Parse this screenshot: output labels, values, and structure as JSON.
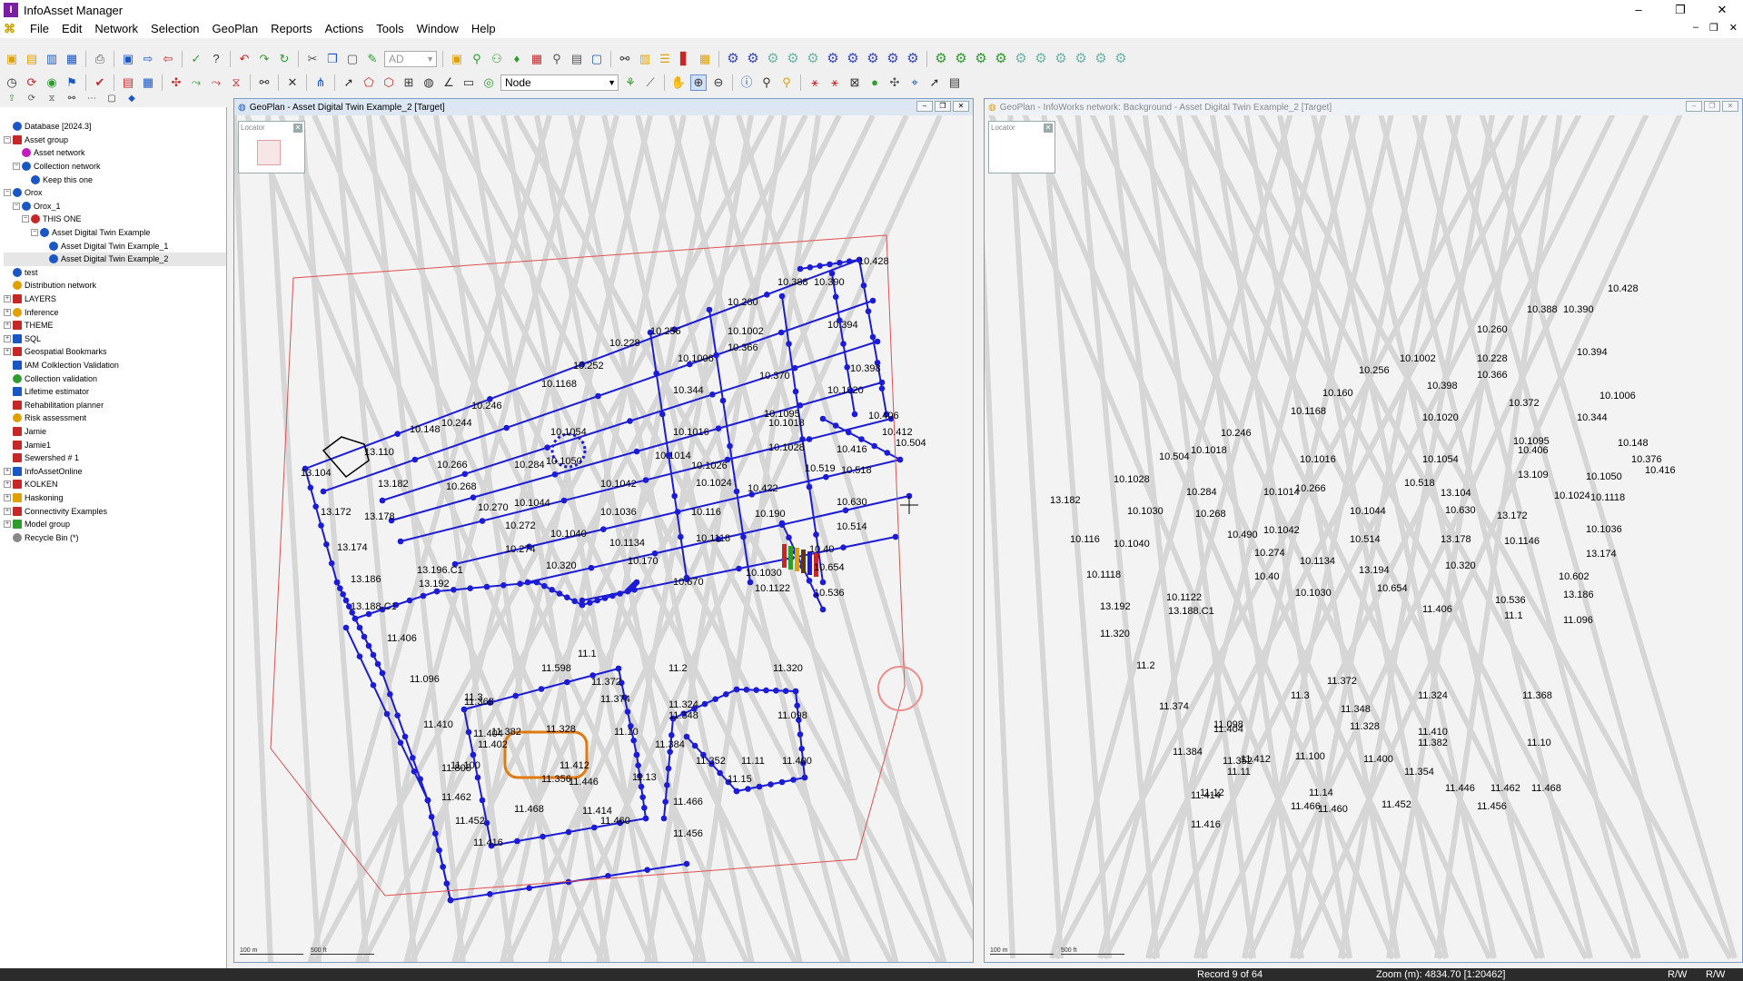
{
  "app": {
    "title": "InfoAsset Manager"
  },
  "window_controls": {
    "minimize": "–",
    "maximize": "❐",
    "close": "✕"
  },
  "menu": [
    "File",
    "Edit",
    "Network",
    "Selection",
    "GeoPlan",
    "Reports",
    "Actions",
    "Tools",
    "Window",
    "Help"
  ],
  "mdi_controls": {
    "minimize": "–",
    "restore": "❐",
    "close": "✕"
  },
  "toolbar": {
    "ad_combo": "AD",
    "node_combo": "Node"
  },
  "tree": [
    {
      "label": "Database [2024.3]",
      "level": 0,
      "pm": "",
      "icon": "#1a56c4"
    },
    {
      "label": "Asset group",
      "level": 0,
      "pm": "−",
      "icon": "#c62828",
      "sq": true
    },
    {
      "label": "Asset network",
      "level": 1,
      "pm": "",
      "icon": "#c41bc4"
    },
    {
      "label": "Collection network",
      "level": 1,
      "pm": "−",
      "icon": "#1a56c4"
    },
    {
      "label": "Keep this one",
      "level": 2,
      "pm": "",
      "icon": "#1a56c4"
    },
    {
      "label": "Orox",
      "level": 0,
      "pm": "−",
      "icon": "#1a56c4"
    },
    {
      "label": "Orox_1",
      "level": 1,
      "pm": "−",
      "icon": "#1a56c4"
    },
    {
      "label": "THIS ONE",
      "level": 2,
      "pm": "−",
      "icon": "#c62828"
    },
    {
      "label": "Asset Digital Twin Example",
      "level": 3,
      "pm": "−",
      "icon": "#1a56c4"
    },
    {
      "label": "Asset Digital Twin Example_1",
      "level": 4,
      "pm": "",
      "icon": "#1a56c4"
    },
    {
      "label": "Asset Digital Twin Example_2",
      "level": 4,
      "pm": "",
      "icon": "#1a56c4",
      "selected": true
    },
    {
      "label": "test",
      "level": 0,
      "pm": "",
      "icon": "#1a56c4"
    },
    {
      "label": "Distribution network",
      "level": 0,
      "pm": "",
      "icon": "#e0a000"
    },
    {
      "label": "LAYERS",
      "level": 0,
      "pm": "+",
      "icon": "#c62828",
      "sq": true
    },
    {
      "label": "Inference",
      "level": 0,
      "pm": "+",
      "icon": "#e0a000"
    },
    {
      "label": "THEME",
      "level": 0,
      "pm": "+",
      "icon": "#c62828",
      "sq": true
    },
    {
      "label": "SQL",
      "level": 0,
      "pm": "+",
      "icon": "#1a56c4",
      "sq": true
    },
    {
      "label": "Geospatial Bookmarks",
      "level": 0,
      "pm": "+",
      "icon": "#c62828",
      "sq": true
    },
    {
      "label": "IAM Colklection Validation",
      "level": 0,
      "pm": "",
      "icon": "#1a56c4",
      "sq": true
    },
    {
      "label": "Collection validation",
      "level": 0,
      "pm": "",
      "icon": "#2e9d2e"
    },
    {
      "label": "Lifetime estimator",
      "level": 0,
      "pm": "",
      "icon": "#1a56c4",
      "sq": true
    },
    {
      "label": "Rehabilitation planner",
      "level": 0,
      "pm": "",
      "icon": "#c62828",
      "sq": true
    },
    {
      "label": "Risk assessment",
      "level": 0,
      "pm": "",
      "icon": "#e0a000"
    },
    {
      "label": "Jamie",
      "level": 0,
      "pm": "",
      "icon": "#c62828",
      "sq": true
    },
    {
      "label": "Jamie1",
      "level": 0,
      "pm": "",
      "icon": "#c62828",
      "sq": true
    },
    {
      "label": "Sewershed # 1",
      "level": 0,
      "pm": "",
      "icon": "#c62828",
      "sq": true
    },
    {
      "label": "InfoAssetOnline",
      "level": 0,
      "pm": "+",
      "icon": "#1a56c4",
      "sq": true
    },
    {
      "label": "KOLKEN",
      "level": 0,
      "pm": "+",
      "icon": "#c62828",
      "sq": true
    },
    {
      "label": "Haskoning",
      "level": 0,
      "pm": "+",
      "icon": "#e0a000",
      "sq": true
    },
    {
      "label": "Connectivity Examples",
      "level": 0,
      "pm": "+",
      "icon": "#c62828",
      "sq": true
    },
    {
      "label": "Model group",
      "level": 0,
      "pm": "+",
      "icon": "#2e9d2e",
      "sq": true
    },
    {
      "label": "Recycle Bin (*)",
      "level": 0,
      "pm": "",
      "icon": "#888"
    }
  ],
  "geoplan_left": {
    "title": "GeoPlan - Asset Digital Twin Example_2 [Target]",
    "locator": "Locator",
    "scale_m": "100 m",
    "scale_ft": "500 ft"
  },
  "geoplan_right": {
    "title": "GeoPlan - InfoWorks network: Background - Asset Digital Twin Example_2 [Target]",
    "locator": "Locator",
    "scale_m": "100 m",
    "scale_ft": "500 ft"
  },
  "labels_left": [
    "10.428",
    "10.388",
    "10.390",
    "10.260",
    "10.394",
    "10.256",
    "10.1002",
    "10.228",
    "10.366",
    "10.1006",
    "10.252",
    "10.398",
    "10.370",
    "10.1168",
    "10.344",
    "10.1020",
    "10.246",
    "10.1095",
    "10.244",
    "10.1018",
    "10.406",
    "10.148",
    "10.1016",
    "10.412",
    "10.1054",
    "10.504",
    "13.110",
    "10.1028",
    "10.1050",
    "10.266",
    "10.416",
    "10.284",
    "10.1014",
    "10.1026",
    "10.519",
    "10.518",
    "13.104",
    "10.268",
    "13.182",
    "10.1042",
    "10.1024",
    "10.422",
    "10.1044",
    "10.630",
    "13.172",
    "10.1036",
    "10.116",
    "10.190",
    "13.178",
    "10.270",
    "10.514",
    "10.272",
    "10.1040",
    "13.174",
    "10.274",
    "10.1134",
    "10.1118",
    "10.40",
    "10.320",
    "10.170",
    "10.654",
    "13.186",
    "13.196.C1",
    "10.1030",
    "13.192",
    "10.670",
    "10.1122",
    "10.536",
    "13.188.C1",
    "11.406",
    "11.1",
    "11.598",
    "11.2",
    "11.320",
    "11.096",
    "11.372",
    "11.3",
    "11.324",
    "11.368",
    "11.374",
    "11.348",
    "11.098",
    "11.410",
    "11.404",
    "11.328",
    "11.382",
    "11.10",
    "11.402",
    "11.384",
    "11.352",
    "11.100",
    "11.412",
    "11.11",
    "11.400",
    "11.808",
    "11.356",
    "11.13",
    "11.446",
    "11.15",
    "11.462",
    "11.468",
    "11.414",
    "11.466",
    "11.452",
    "11.460",
    "11.456",
    "11.416"
  ],
  "labels_right": [
    "10.428",
    "10.388",
    "10.390",
    "10.260",
    "10.394",
    "10.1002",
    "10.228",
    "10.256",
    "10.366",
    "10.398",
    "10.160",
    "10.1006",
    "10.372",
    "10.1168",
    "10.1020",
    "10.344",
    "10.246",
    "10.1095",
    "10.1018",
    "10.406",
    "10.148",
    "10.504",
    "10.1054",
    "10.376",
    "10.1016",
    "10.416",
    "10.1028",
    "13.109",
    "10.266",
    "10.284",
    "10.1050",
    "10.1014",
    "10.518",
    "13.104",
    "10.1024",
    "10.1118",
    "13.182",
    "10.268",
    "10.1030",
    "10.1044",
    "10.630",
    "13.172",
    "10.1042",
    "10.1036",
    "10.116",
    "10.514",
    "13.178",
    "10.1146",
    "10.1040",
    "10.490",
    "13.174",
    "10.274",
    "10.1134",
    "10.1118",
    "10.40",
    "13.194",
    "10.320",
    "10.602",
    "10.1030",
    "10.654",
    "13.186",
    "13.192",
    "10.1122",
    "10.536",
    "13.188.C1",
    "11.406",
    "11.1",
    "11.096",
    "11.320",
    "11.2",
    "11.372",
    "11.3",
    "11.324",
    "11.368",
    "11.374",
    "11.348",
    "11.098",
    "11.410",
    "11.404",
    "11.328",
    "11.382",
    "11.10",
    "11.384",
    "11.352",
    "11.100",
    "11.412",
    "11.400",
    "11.11",
    "11.354",
    "11.446",
    "11.12",
    "11.14",
    "11.462",
    "11.468",
    "11.414",
    "11.466",
    "11.452",
    "11.460",
    "11.456",
    "11.416"
  ],
  "status": {
    "record": "Record 9 of 64",
    "zoom": "Zoom (m): 4834.70 [1:20462]",
    "rw": "R/W",
    "rw2": "R/W"
  },
  "colors": {
    "network": "#1c1cd6",
    "selection": "#e05050",
    "accent": "#1a56c4"
  }
}
